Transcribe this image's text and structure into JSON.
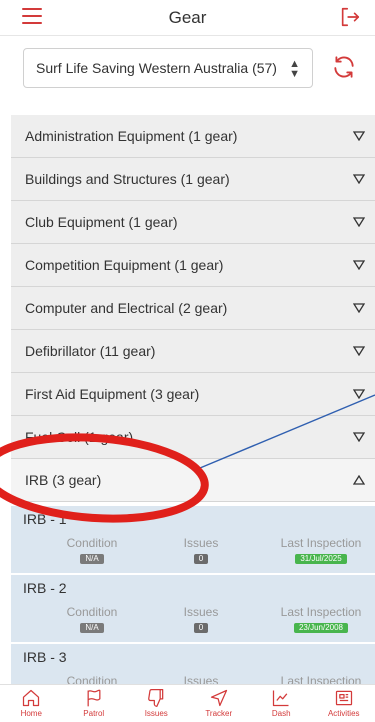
{
  "header": {
    "title": "Gear"
  },
  "club_selector": {
    "value": "Surf Life Saving Western Australia (57)",
    "caret": "⬍"
  },
  "categories": [
    {
      "label": "Administration Equipment (1 gear)",
      "state": "collapsed"
    },
    {
      "label": "Buildings and Structures (1 gear)",
      "state": "collapsed"
    },
    {
      "label": "Club Equipment (1 gear)",
      "state": "collapsed"
    },
    {
      "label": "Competition Equipment (1 gear)",
      "state": "collapsed"
    },
    {
      "label": "Computer and Electrical (2 gear)",
      "state": "collapsed"
    },
    {
      "label": "Defibrillator (11 gear)",
      "state": "collapsed"
    },
    {
      "label": "First Aid Equipment (3 gear)",
      "state": "collapsed"
    },
    {
      "label": "Fuel Cell (1 gear)",
      "state": "collapsed"
    },
    {
      "label": "IRB (3 gear)",
      "state": "expanded"
    }
  ],
  "gear_columns": {
    "condition": "Condition",
    "issues": "Issues",
    "last_inspection": "Last Inspection"
  },
  "gear_items": [
    {
      "name": "IRB - 1",
      "condition": "N/A",
      "issues": "0",
      "last_inspection": "31/Jul/2025"
    },
    {
      "name": "IRB - 2",
      "condition": "N/A",
      "issues": "0",
      "last_inspection": "23/Jun/2008"
    },
    {
      "name": "IRB - 3",
      "condition": "",
      "issues": "",
      "last_inspection": ""
    }
  ],
  "bottom_nav": {
    "home": "Home",
    "patrol": "Patrol",
    "issues": "Issues",
    "tracker": "Tracker",
    "dash": "Dash",
    "activities": "Activities"
  },
  "colors": {
    "accent": "#d33a3a",
    "gear_bg": "#dbe6f0",
    "category_bg": "#eeeeee",
    "badge_green": "#48b54d",
    "annotation_red": "#e0201b",
    "annotation_line": "#2f5fb0"
  }
}
